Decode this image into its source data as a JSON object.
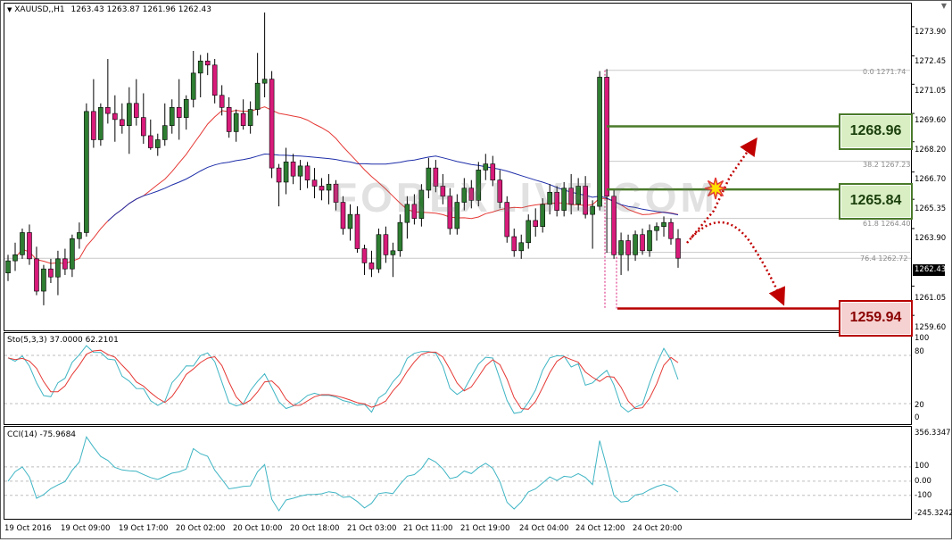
{
  "window": {
    "symbol_label": "XAUUSD,,H1",
    "ohlc": "1263.43 1263.87 1261.96 1262.43"
  },
  "price_axis": {
    "labels": [
      "1273.90",
      "1272.45",
      "1271.05",
      "1269.60",
      "1268.20",
      "1266.70",
      "1265.35",
      "1263.90",
      "1261.05",
      "1259.60"
    ],
    "current_price": "1262.43"
  },
  "fibonacci": {
    "level_0": "0.0  1271.74",
    "level_382": "38.2  1267.23",
    "level_618": "61.8  1264.40",
    "level_764": "76.4  1262.72"
  },
  "levels": {
    "upper_resistance": "1268.96",
    "mid_level": "1265.84",
    "support": "1259.94"
  },
  "watermark": "FOREXLIVE.COM",
  "stochastic": {
    "label": "Sto(5,3,3) 37.0000 62.2101",
    "axis": [
      "100",
      "80",
      "20",
      "0"
    ]
  },
  "cci": {
    "label": "CCI(14) -75.9684",
    "axis": [
      "356.3347",
      "100",
      "0.00",
      "-100",
      "-245.3242"
    ]
  },
  "time_axis": [
    "19 Oct 2016",
    "19 Oct 09:00",
    "19 Oct 17:00",
    "20 Oct 02:00",
    "20 Oct 10:00",
    "20 Oct 18:00",
    "21 Oct 03:00",
    "21 Oct 11:00",
    "21 Oct 19:00",
    "24 Oct 04:00",
    "24 Oct 12:00",
    "24 Oct 20:00"
  ],
  "colors": {
    "bull_candle": "#2e7d32",
    "bear_candle": "#d81b7a",
    "ma_fast": "#e53935",
    "ma_slow": "#1e2ea8",
    "stoch_main": "#3fb5c4",
    "stoch_signal": "#e53935",
    "cci_line": "#3fb5c4",
    "level_green": "#4a7a2a",
    "level_red": "#b80000"
  },
  "chart_data": {
    "type": "candlestick",
    "symbol": "XAUUSD",
    "timeframe": "H1",
    "ylim": [
      1258.9,
      1275.0
    ],
    "candles": [
      [
        1261.7,
        1262.6,
        1261.3,
        1262.3
      ],
      [
        1262.3,
        1263.2,
        1261.8,
        1262.6
      ],
      [
        1262.6,
        1263.9,
        1262.4,
        1263.7
      ],
      [
        1263.7,
        1264.1,
        1262.1,
        1262.4
      ],
      [
        1262.4,
        1263.0,
        1260.6,
        1260.8
      ],
      [
        1260.8,
        1262.1,
        1260.1,
        1261.9
      ],
      [
        1261.9,
        1262.4,
        1261.2,
        1261.5
      ],
      [
        1261.5,
        1262.8,
        1260.6,
        1262.4
      ],
      [
        1262.4,
        1262.9,
        1261.6,
        1261.9
      ],
      [
        1261.9,
        1263.6,
        1261.5,
        1263.4
      ],
      [
        1263.4,
        1264.2,
        1262.9,
        1263.7
      ],
      [
        1263.7,
        1270.1,
        1263.5,
        1269.7
      ],
      [
        1269.7,
        1271.3,
        1267.9,
        1268.3
      ],
      [
        1268.3,
        1270.1,
        1268.0,
        1269.9
      ],
      [
        1269.9,
        1272.3,
        1269.1,
        1269.6
      ],
      [
        1269.6,
        1270.5,
        1268.2,
        1269.3
      ],
      [
        1269.3,
        1270.1,
        1268.6,
        1269.0
      ],
      [
        1269.0,
        1270.9,
        1267.6,
        1270.1
      ],
      [
        1270.1,
        1271.3,
        1269.0,
        1269.4
      ],
      [
        1269.4,
        1270.6,
        1268.1,
        1268.5
      ],
      [
        1268.5,
        1269.3,
        1267.8,
        1267.9
      ],
      [
        1267.9,
        1268.6,
        1267.5,
        1268.3
      ],
      [
        1268.3,
        1270.1,
        1268.0,
        1269.0
      ],
      [
        1269.0,
        1270.3,
        1268.6,
        1269.9
      ],
      [
        1269.9,
        1271.3,
        1268.3,
        1269.4
      ],
      [
        1269.4,
        1270.5,
        1268.8,
        1270.3
      ],
      [
        1270.3,
        1272.7,
        1269.9,
        1271.6
      ],
      [
        1271.6,
        1272.5,
        1270.4,
        1272.2
      ],
      [
        1272.2,
        1272.6,
        1271.5,
        1272.0
      ],
      [
        1272.0,
        1272.3,
        1270.1,
        1270.5
      ],
      [
        1270.5,
        1271.0,
        1269.5,
        1269.9
      ],
      [
        1269.9,
        1270.4,
        1268.4,
        1268.7
      ],
      [
        1268.7,
        1269.8,
        1268.2,
        1269.6
      ],
      [
        1269.6,
        1270.3,
        1268.8,
        1269.0
      ],
      [
        1269.0,
        1270.2,
        1268.6,
        1269.8
      ],
      [
        1269.8,
        1272.6,
        1269.5,
        1271.1
      ],
      [
        1271.1,
        1274.6,
        1270.4,
        1271.3
      ],
      [
        1271.3,
        1271.7,
        1266.4,
        1266.9
      ],
      [
        1266.9,
        1267.1,
        1265.0,
        1266.2
      ],
      [
        1266.2,
        1267.9,
        1265.6,
        1267.2
      ],
      [
        1267.2,
        1267.6,
        1266.1,
        1266.5
      ],
      [
        1266.5,
        1267.3,
        1265.8,
        1267.0
      ],
      [
        1267.0,
        1267.2,
        1265.9,
        1266.3
      ],
      [
        1266.3,
        1266.9,
        1265.4,
        1266.0
      ],
      [
        1266.0,
        1266.4,
        1265.3,
        1265.8
      ],
      [
        1265.8,
        1266.6,
        1265.1,
        1266.1
      ],
      [
        1266.1,
        1266.3,
        1264.8,
        1265.2
      ],
      [
        1265.2,
        1265.5,
        1263.6,
        1263.9
      ],
      [
        1263.9,
        1265.1,
        1263.3,
        1264.6
      ],
      [
        1264.6,
        1265.0,
        1262.7,
        1262.9
      ],
      [
        1262.9,
        1263.1,
        1261.6,
        1262.2
      ],
      [
        1262.2,
        1262.8,
        1261.5,
        1261.9
      ],
      [
        1261.9,
        1263.9,
        1261.7,
        1263.6
      ],
      [
        1263.6,
        1264.0,
        1262.2,
        1262.6
      ],
      [
        1262.6,
        1263.2,
        1261.5,
        1262.8
      ],
      [
        1262.8,
        1264.6,
        1262.5,
        1264.2
      ],
      [
        1264.2,
        1265.5,
        1263.4,
        1265.1
      ],
      [
        1265.1,
        1265.6,
        1264.1,
        1264.4
      ],
      [
        1264.4,
        1266.1,
        1264.0,
        1265.8
      ],
      [
        1265.8,
        1267.4,
        1265.4,
        1266.9
      ],
      [
        1266.9,
        1267.3,
        1265.7,
        1266.0
      ],
      [
        1266.0,
        1266.6,
        1265.1,
        1265.5
      ],
      [
        1265.5,
        1265.9,
        1263.6,
        1263.9
      ],
      [
        1263.9,
        1265.6,
        1263.6,
        1265.2
      ],
      [
        1265.2,
        1266.4,
        1264.8,
        1265.9
      ],
      [
        1265.9,
        1266.3,
        1264.9,
        1265.3
      ],
      [
        1265.3,
        1267.2,
        1265.0,
        1266.8
      ],
      [
        1266.8,
        1267.6,
        1266.3,
        1267.1
      ],
      [
        1267.1,
        1267.5,
        1266.0,
        1266.3
      ],
      [
        1266.3,
        1266.8,
        1264.9,
        1265.2
      ],
      [
        1265.2,
        1265.5,
        1263.2,
        1263.5
      ],
      [
        1263.5,
        1263.9,
        1262.5,
        1262.8
      ],
      [
        1262.8,
        1263.6,
        1262.4,
        1263.2
      ],
      [
        1263.2,
        1264.6,
        1262.9,
        1264.3
      ],
      [
        1264.3,
        1264.9,
        1263.5,
        1264.0
      ],
      [
        1264.0,
        1265.4,
        1263.7,
        1265.1
      ],
      [
        1265.1,
        1266.1,
        1264.6,
        1265.7
      ],
      [
        1265.7,
        1266.0,
        1264.5,
        1264.8
      ],
      [
        1264.8,
        1266.2,
        1264.5,
        1265.9
      ],
      [
        1265.9,
        1266.6,
        1264.6,
        1265.1
      ],
      [
        1265.1,
        1266.4,
        1264.8,
        1266.0
      ],
      [
        1266.0,
        1266.5,
        1264.4,
        1264.6
      ],
      [
        1264.6,
        1265.3,
        1262.9,
        1265.0
      ],
      [
        1265.0,
        1271.7,
        1264.8,
        1271.4
      ],
      [
        1271.4,
        1271.8,
        1262.7,
        1265.5
      ],
      [
        1265.5,
        1265.8,
        1262.4,
        1262.6
      ],
      [
        1262.6,
        1263.7,
        1261.6,
        1263.3
      ],
      [
        1263.3,
        1263.6,
        1261.8,
        1262.6
      ],
      [
        1262.6,
        1263.8,
        1262.3,
        1263.6
      ],
      [
        1263.6,
        1263.9,
        1262.6,
        1262.8
      ],
      [
        1262.8,
        1264.1,
        1262.5,
        1263.8
      ],
      [
        1263.8,
        1264.2,
        1263.3,
        1264.0
      ],
      [
        1264.0,
        1264.5,
        1263.5,
        1264.2
      ],
      [
        1264.2,
        1264.4,
        1263.1,
        1263.4
      ],
      [
        1263.4,
        1263.87,
        1261.96,
        1262.43
      ]
    ],
    "fib_levels": [
      {
        "label": "0.0",
        "value": 1271.74
      },
      {
        "label": "38.2",
        "value": 1267.23
      },
      {
        "label": "61.8",
        "value": 1264.4
      },
      {
        "label": "76.4",
        "value": 1262.72
      }
    ],
    "horizontal_levels": [
      1268.96,
      1265.84,
      1259.94
    ],
    "stochastic": {
      "ylim": [
        0,
        100
      ]
    },
    "cci": {
      "ylim": [
        -245.3242,
        356.3347
      ]
    }
  }
}
